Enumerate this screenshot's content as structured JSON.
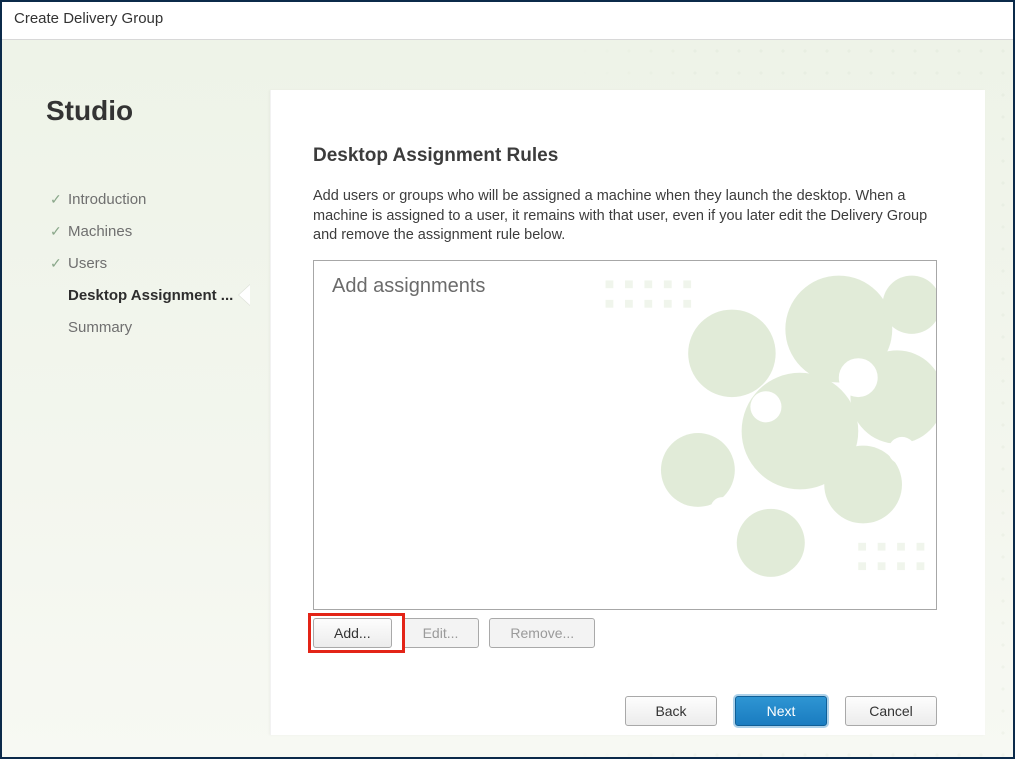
{
  "window": {
    "title": "Create Delivery Group"
  },
  "sidebar": {
    "brand": "Studio",
    "steps": [
      {
        "label": "Introduction",
        "done": true,
        "current": false
      },
      {
        "label": "Machines",
        "done": true,
        "current": false
      },
      {
        "label": "Users",
        "done": true,
        "current": false
      },
      {
        "label": "Desktop Assignment ...",
        "done": false,
        "current": true
      },
      {
        "label": "Summary",
        "done": false,
        "current": false
      }
    ]
  },
  "main": {
    "title": "Desktop Assignment Rules",
    "description": "Add users or groups who will be assigned a machine when they launch the desktop. When a machine is assigned to a user, it remains with that user, even if you later edit the Delivery Group and remove the assignment rule below.",
    "listbox_placeholder": "Add assignments",
    "buttons": {
      "add": "Add...",
      "edit": "Edit...",
      "remove": "Remove..."
    }
  },
  "footer": {
    "back": "Back",
    "next": "Next",
    "cancel": "Cancel"
  }
}
